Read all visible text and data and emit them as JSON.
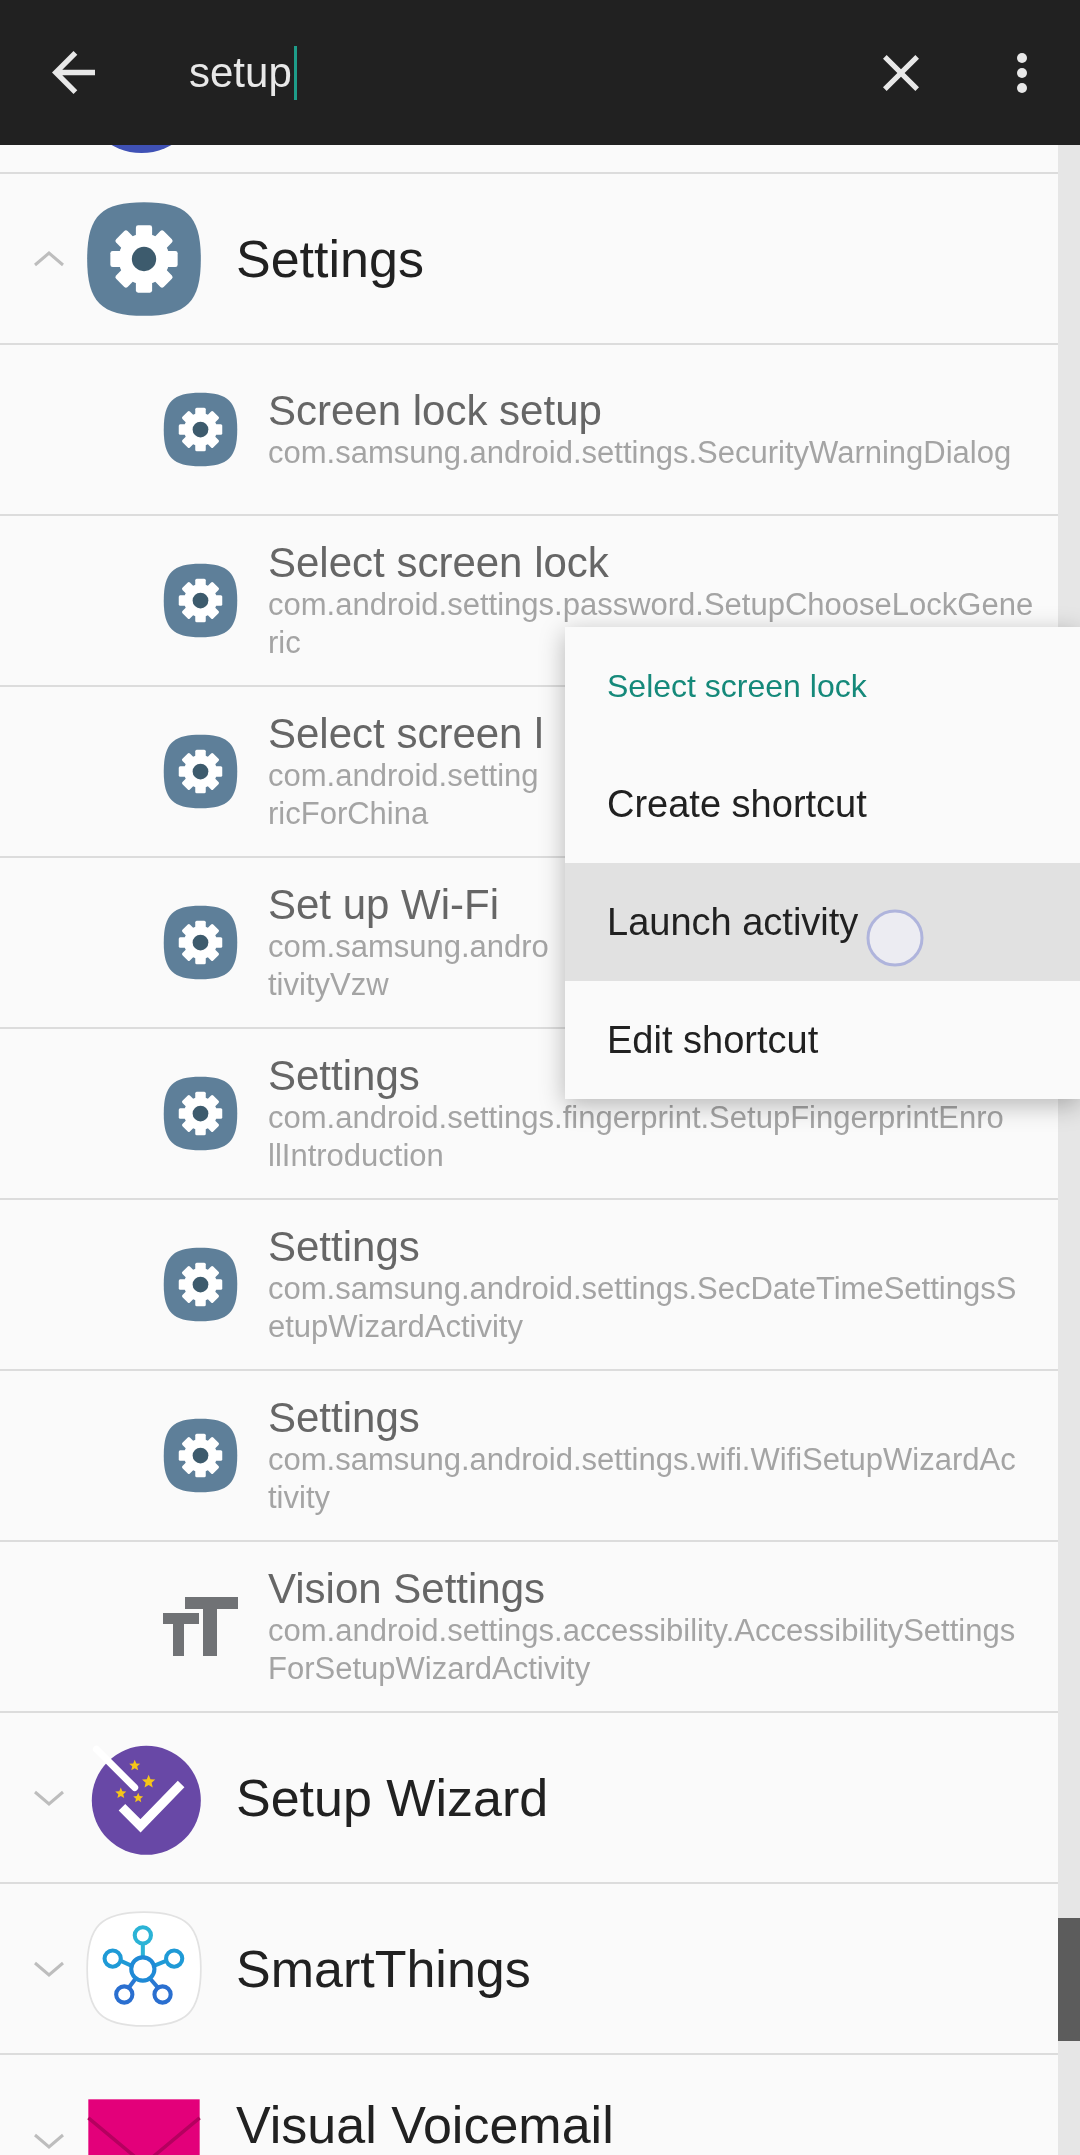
{
  "search_bar": {
    "value": "setup"
  },
  "groups": [
    {
      "kind": "settings",
      "title": "Settings",
      "expanded": true,
      "children": [
        {
          "kind": "gear",
          "title": "Screen lock setup",
          "subtitle_lines": [
            "com.samsung.android.settings.SecurityWarningDialog"
          ]
        },
        {
          "kind": "gear",
          "title": "Select screen lock",
          "subtitle_lines": [
            "com.android.settings.password.SetupChooseLockGene",
            "ric"
          ]
        },
        {
          "kind": "gear",
          "title": "Select screen l",
          "subtitle_lines": [
            "com.android.setting",
            "ricForChina"
          ]
        },
        {
          "kind": "gear",
          "title": "Set up Wi-Fi",
          "subtitle_lines": [
            "com.samsung.andro",
            "tivityVzw"
          ]
        },
        {
          "kind": "gear",
          "title": "Settings",
          "subtitle_lines": [
            "com.android.settings.fingerprint.SetupFingerprintEnro",
            "llIntroduction"
          ]
        },
        {
          "kind": "gear",
          "title": "Settings",
          "subtitle_lines": [
            "com.samsung.android.settings.SecDateTimeSettingsS",
            "etupWizardActivity"
          ]
        },
        {
          "kind": "gear",
          "title": "Settings",
          "subtitle_lines": [
            "com.samsung.android.settings.wifi.WifiSetupWizardAc",
            "tivity"
          ]
        },
        {
          "kind": "text_size",
          "title": "Vision Settings",
          "subtitle_lines": [
            "com.android.settings.accessibility.AccessibilitySettings",
            "ForSetupWizardActivity"
          ]
        }
      ]
    },
    {
      "kind": "setup_wizard",
      "title": "Setup Wizard",
      "expanded": false
    },
    {
      "kind": "smartthings",
      "title": "SmartThings",
      "expanded": false
    },
    {
      "kind": "voicemail",
      "title": "Visual Voicemail",
      "expanded": false
    }
  ],
  "context_menu": {
    "title": "Select screen lock",
    "items": [
      {
        "label": "Create shortcut",
        "selected": false
      },
      {
        "label": "Launch activity",
        "selected": true
      },
      {
        "label": "Edit shortcut",
        "selected": false
      }
    ]
  }
}
